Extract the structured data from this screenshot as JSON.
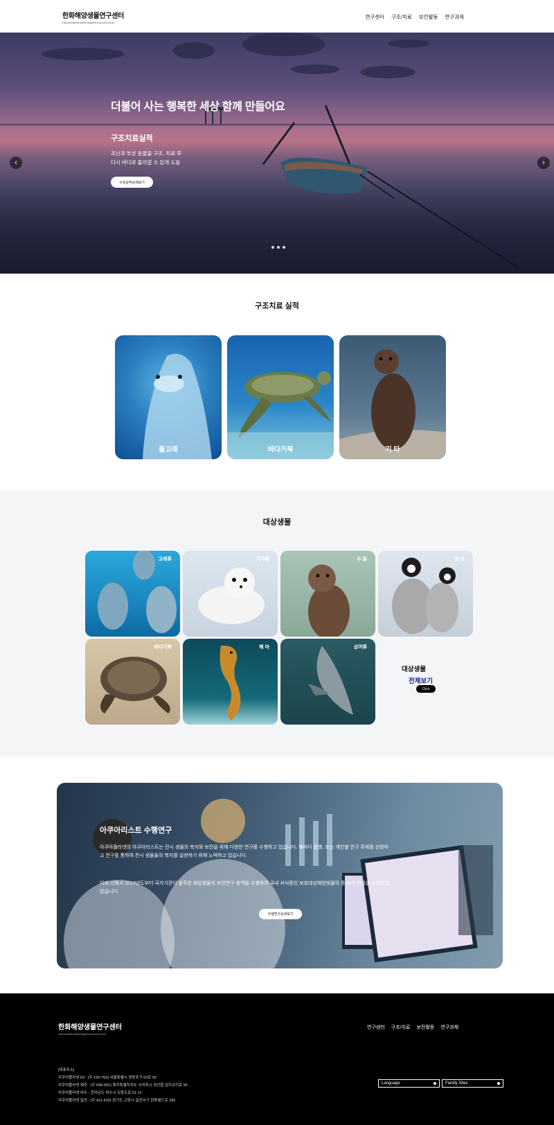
{
  "header": {
    "logo_ko": "한화해양생물연구센터",
    "logo_en": "HanwhaMarineBiologyResearchCenter",
    "nav": [
      "연구센터",
      "구조/치료",
      "보전활동",
      "연구과제"
    ]
  },
  "hero": {
    "headline": "더불어 사는 행복한 세상 함께 만들어요",
    "subtitle": "구조치료실적",
    "desc_line1": "조난과 부상 동물을 구조, 치료 후",
    "desc_line2": "다시 바다로 돌아갈 수 있게 도움",
    "button": "구조실적상세보기",
    "prev": "‹",
    "next": "›"
  },
  "rescue": {
    "title": "구조치료 실적",
    "cards": [
      "돌고래",
      "바다거북",
      "기 타"
    ]
  },
  "species": {
    "title": "대상생물",
    "tiles": [
      "고래류",
      "기각류",
      "수 달",
      "펭 귄",
      "바다거북",
      "해 마",
      "상어류"
    ],
    "all_label1": "대상생물",
    "all_label2": "전체보기",
    "click": "Click"
  },
  "aquarist": {
    "title": "아쿠아리스트 수행연구",
    "p1": "아쿠아플라넷의 아쿠아리스트는 전시 생물의 복지와 보전을 위해 다양한 연구를 수행하고 있습니다. 해마다 참병, 또는 개인별 연구 주제를 선정하고 연구를 통하여 전시 생물들의 복지를 실현하기 위해 노력하고 있습니다.",
    "p2": "이에 더해서 2013년도부터 국가기관이 발주한 해양생물의 보전연구 용역을 수행하여 국내 서식중인 보호대상해양생물의 종 보전 역할을 수행하고 있습니다.",
    "button": "수행연구상세보기"
  },
  "footer": {
    "logo_ko": "한화해양생물연구센터",
    "logo_en": "HanwhaMarineBiologyResearchCenter",
    "nav": [
      "연구센터",
      "구조/치료",
      "보전활동",
      "연구과제"
    ],
    "addr_title": "[대표주소]",
    "addr": [
      "아쿠아플라넷 63 : (우 150-763) 서울특별시 영등포구 63로 50",
      "아쿠아플라넷 제주 : (우 699-901) 제주특별자치도 서귀포시 성산읍 섭지코지로 95",
      "아쿠아플라넷 여수 : 전라남도 여수시 오동도로 61-11",
      "아쿠아플라넷 일산 : (우 411-430) 경기도 고양시 일산서구 한류월드로 282"
    ],
    "language": "Language",
    "family": "Family Sites"
  }
}
